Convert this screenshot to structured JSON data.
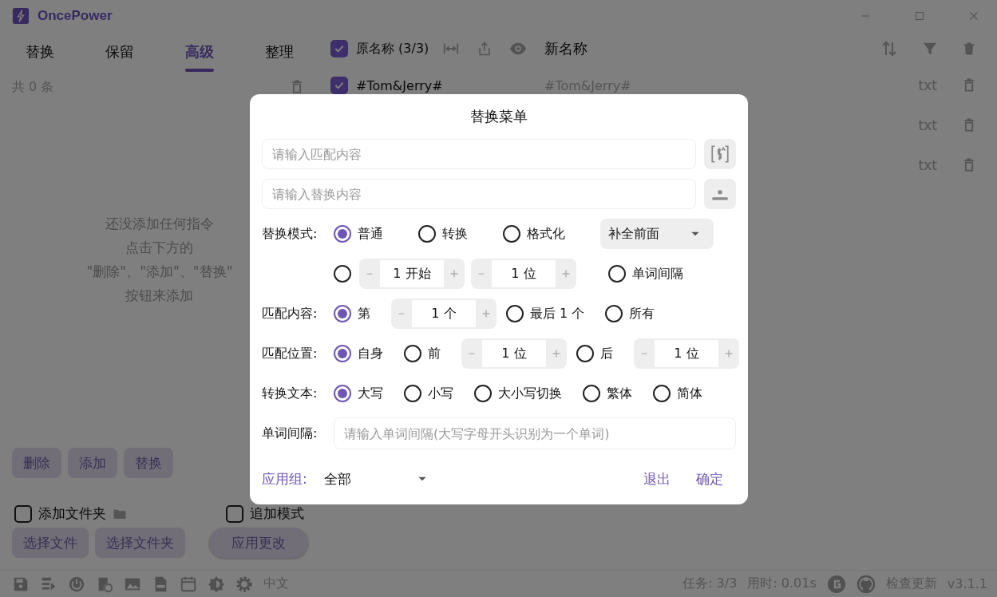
{
  "window": {
    "title": "OncePower"
  },
  "tabs": [
    {
      "label": "替换",
      "selected": false
    },
    {
      "label": "保留",
      "selected": false
    },
    {
      "label": "高级",
      "selected": true
    },
    {
      "label": "整理",
      "selected": false
    }
  ],
  "left_panel": {
    "count": "共 0 条",
    "empty_message": [
      "还没添加任何指令",
      "点击下方的",
      "\"删除\"、\"添加\"、\"替换\"",
      "按钮来添加"
    ],
    "action_buttons": [
      "删除",
      "添加",
      "替换"
    ],
    "checkboxes": [
      {
        "label": "添加文件夹",
        "checked": false
      },
      {
        "label": "追加模式",
        "checked": false
      }
    ],
    "bottom_buttons": [
      "选择文件",
      "选择文件夹",
      "应用更改"
    ]
  },
  "file_list": {
    "header": {
      "checked": true,
      "original_label": "原名称 (3/3)",
      "new_label": "新名称"
    },
    "rows": [
      {
        "checked": true,
        "name": "#Tom&Jerry#",
        "new_name": "#Tom&Jerry#",
        "ext": "txt"
      },
      {
        "ext": "txt"
      },
      {
        "ext": "txt"
      }
    ]
  },
  "dialog": {
    "title": "替换菜单",
    "match_field": {
      "placeholder": "请输入匹配内容"
    },
    "replace_field": {
      "placeholder": "请输入替换内容"
    },
    "rows": [
      {
        "label": "替换模式:",
        "items": [
          {
            "kind": "radio",
            "label": "普通",
            "selected": true
          },
          {
            "kind": "radio",
            "label": "转换",
            "selected": false
          },
          {
            "kind": "radio",
            "label": "格式化",
            "selected": false
          },
          {
            "kind": "dropdown",
            "value": "补全前面"
          }
        ]
      },
      {
        "items": [
          {
            "kind": "radio",
            "selected": false
          },
          {
            "kind": "stepper",
            "value": "1 开始"
          },
          {
            "kind": "stepper",
            "value": "1 位"
          },
          {
            "kind": "radio",
            "label": "单词间隔",
            "selected": false
          }
        ]
      },
      {
        "label": "匹配内容:",
        "items": [
          {
            "kind": "radio",
            "label": "第",
            "selected": true
          },
          {
            "kind": "stepper",
            "value": "1 个"
          },
          {
            "kind": "radio",
            "label": "最后 1 个",
            "selected": false
          },
          {
            "kind": "radio",
            "label": "所有",
            "selected": false
          }
        ]
      },
      {
        "label": "匹配位置:",
        "items": [
          {
            "kind": "radio",
            "label": "自身",
            "selected": true
          },
          {
            "kind": "radio",
            "label": "前",
            "selected": false
          },
          {
            "kind": "stepper",
            "value": "1 位"
          },
          {
            "kind": "radio",
            "label": "后",
            "selected": false
          },
          {
            "kind": "stepper",
            "value": "1 位"
          }
        ]
      },
      {
        "label": "转换文本:",
        "items": [
          {
            "kind": "radio",
            "label": "大写",
            "selected": true
          },
          {
            "kind": "radio",
            "label": "小写",
            "selected": false
          },
          {
            "kind": "radio",
            "label": "大小写切换",
            "selected": false
          },
          {
            "kind": "radio",
            "label": "繁体",
            "selected": false
          },
          {
            "kind": "radio",
            "label": "简体",
            "selected": false
          }
        ]
      },
      {
        "label": "单词间隔:",
        "items": [
          {
            "kind": "field",
            "placeholder": "请输入单词间隔(大写字母开头识别为一个单词)"
          }
        ]
      }
    ],
    "footer": {
      "group_label": "应用组:",
      "group_value": "全部",
      "buttons": [
        "退出",
        "确定"
      ]
    }
  },
  "status_bar": {
    "language": "中文",
    "tasks": "任务: 3/3",
    "time": "用时: 0.01s",
    "update": "检查更新",
    "version": "v3.1.1"
  }
}
